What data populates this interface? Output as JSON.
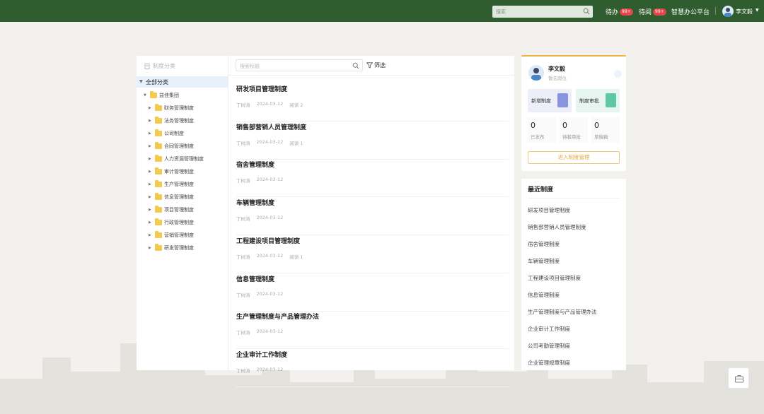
{
  "topbar": {
    "search_placeholder": "搜索",
    "todo_label": "待办",
    "todo_badge": "99+",
    "toread_label": "待阅",
    "toread_badge": "99+",
    "platform_label": "智慧办公平台",
    "user_name": "李文毅",
    "bg_color": "#2f5d2f"
  },
  "sidebar": {
    "header": "制度分类",
    "all_label": "全部分类",
    "root_label": "益佳集团",
    "items": [
      {
        "label": "财务管理制度"
      },
      {
        "label": "法务管理制度"
      },
      {
        "label": "公司制度"
      },
      {
        "label": "合同管理制度"
      },
      {
        "label": "人力资源管理制度"
      },
      {
        "label": "审计管理制度"
      },
      {
        "label": "生产管理制度"
      },
      {
        "label": "信息管理制度"
      },
      {
        "label": "项目管理制度"
      },
      {
        "label": "行政管理制度"
      },
      {
        "label": "营销管理制度"
      },
      {
        "label": "研发管理制度"
      }
    ]
  },
  "main": {
    "search_placeholder": "搜索标题",
    "filter_label": "筛选",
    "docs": [
      {
        "title": "研发项目管理制度",
        "author": "丁树涛",
        "date": "2024-03-12",
        "reads": "阅读 2"
      },
      {
        "title": "销售部营销人员管理制度",
        "author": "丁树涛",
        "date": "2024-03-12",
        "reads": "阅读 1"
      },
      {
        "title": "宿舍管理制度",
        "author": "丁树涛",
        "date": "2024-03-12",
        "reads": ""
      },
      {
        "title": "车辆管理制度",
        "author": "丁树涛",
        "date": "2024-03-12",
        "reads": ""
      },
      {
        "title": "工程建设项目管理制度",
        "author": "丁树涛",
        "date": "2024-03-12",
        "reads": "阅读 1"
      },
      {
        "title": "信息管理制度",
        "author": "丁树涛",
        "date": "2024-03-12",
        "reads": ""
      },
      {
        "title": "生产管理制度与产品管理办法",
        "author": "丁树涛",
        "date": "2024-03-12",
        "reads": ""
      },
      {
        "title": "企业审计工作制度",
        "author": "丁树涛",
        "date": "2024-03-12",
        "reads": ""
      }
    ]
  },
  "profile": {
    "name": "李文毅",
    "position": "暂无岗位",
    "new_btn": "新增制度",
    "review_btn": "制度审批",
    "stats": [
      {
        "value": "0",
        "label": "已发布"
      },
      {
        "value": "0",
        "label": "待我审批"
      },
      {
        "value": "0",
        "label": "草稿箱"
      }
    ],
    "enter_btn": "进入制度管理",
    "accent": "#f1b23f"
  },
  "recent": {
    "title": "最近制度",
    "items": [
      "研发项目管理制度",
      "销售部营销人员管理制度",
      "宿舍管理制度",
      "车辆管理制度",
      "工程建设项目管理制度",
      "信息管理制度",
      "生产管理制度与产品管理办法",
      "企业审计工作制度",
      "公司考勤管理制度",
      "企业管理规章制度"
    ]
  }
}
